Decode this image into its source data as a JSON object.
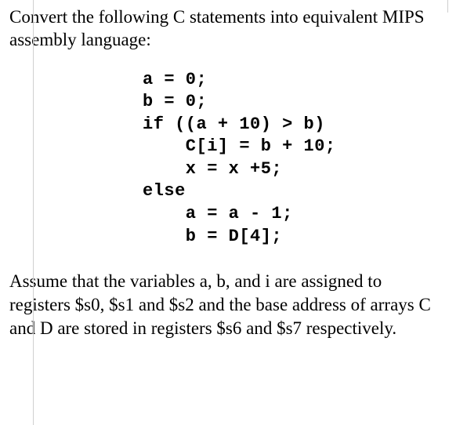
{
  "prompt": "Convert the following C statements into equivalent MIPS assembly language:",
  "code": "a = 0;\nb = 0;\nif ((a + 10) > b)\n    C[i] = b + 10;\n    x = x +5;\nelse\n    a = a - 1;\n    b = D[4];",
  "assumption": "Assume that the variables a, b, and i are assigned to registers $s0, $s1 and $s2 and the base address of arrays C and D are stored in registers $s6 and $s7 respectively."
}
